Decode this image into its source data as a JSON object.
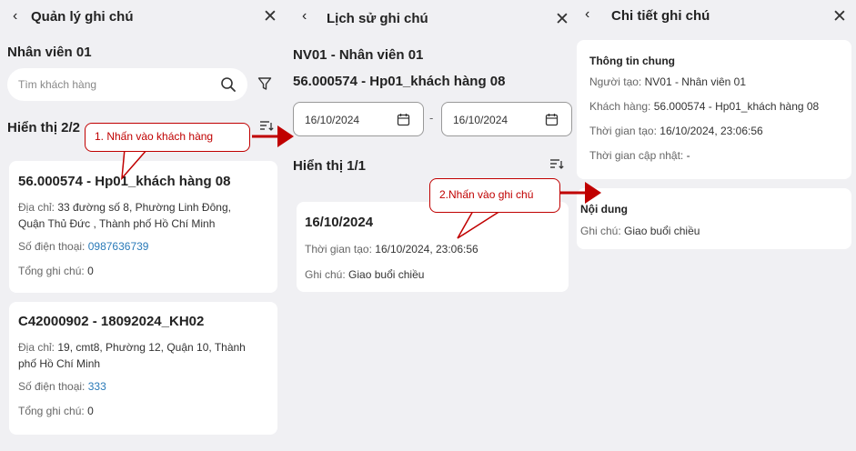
{
  "panel1": {
    "title": "Quản lý ghi chú",
    "back_icon": "‹",
    "close_icon": "✕",
    "employee": "Nhân viên 01",
    "search": {
      "placeholder": "Tìm khách hàng"
    },
    "count_label": "Hiển thị 2/2",
    "customers": [
      {
        "title": "56.000574 - Hp01_khách hàng 08",
        "address_label": "Địa chỉ:",
        "address_line1": "33 đường số 8, Phường Linh Đông,",
        "address_line2": "Quận Thủ Đức , Thành phố Hồ Chí Minh",
        "phone_label": "Số điện thoại:",
        "phone": "0987636739",
        "total_label": "Tổng ghi chú:",
        "total": "0"
      },
      {
        "title": "C42000902 - 18092024_KH02",
        "address_label": "Địa chỉ:",
        "address_line1": "19, cmt8, Phường 12, Quận 10, Thành",
        "address_line2": "phố Hồ Chí Minh",
        "phone_label": "Số điện thoại:",
        "phone": "333",
        "total_label": "Tổng ghi chú:",
        "total": "0"
      }
    ]
  },
  "panel2": {
    "title": "Lịch sử ghi chú",
    "back_icon": "‹",
    "close_icon": "✕",
    "employee": "NV01 - Nhân viên 01",
    "customer": "56.000574 - Hp01_khách hàng 08",
    "date_from": "16/10/2024",
    "date_to": "16/10/2024",
    "date_separator": "-",
    "count_label": "Hiển thị 1/1",
    "note": {
      "date": "16/10/2024",
      "created_label": "Thời gian tạo:",
      "created": "16/10/2024, 23:06:56",
      "note_label": "Ghi chú:",
      "note": "Giao buổi chiều"
    }
  },
  "panel3": {
    "title": "Chi tiết ghi chú",
    "back_icon": "‹",
    "close_icon": "✕",
    "general_title": "Thông tin chung",
    "creator_label": "Người tạo:",
    "creator": "NV01 - Nhân viên 01",
    "customer_label": "Khách hàng:",
    "customer": "56.000574 - Hp01_khách hàng 08",
    "created_label": "Thời gian tạo:",
    "created": "16/10/2024, 23:06:56",
    "updated_label": "Thời gian cập nhật:",
    "updated": "-",
    "content_title": "Nội dung",
    "note_label": "Ghi chú:",
    "note": "Giao buổi chiều"
  },
  "annotations": {
    "callout1": "1. Nhấn vào khách hàng",
    "callout2": "2.Nhấn vào ghi chú",
    "color": "#c00000"
  },
  "icons": [
    "back-icon",
    "close-icon",
    "search-icon",
    "filter-icon",
    "sort-icon",
    "calendar-icon",
    "arrow-icon"
  ]
}
